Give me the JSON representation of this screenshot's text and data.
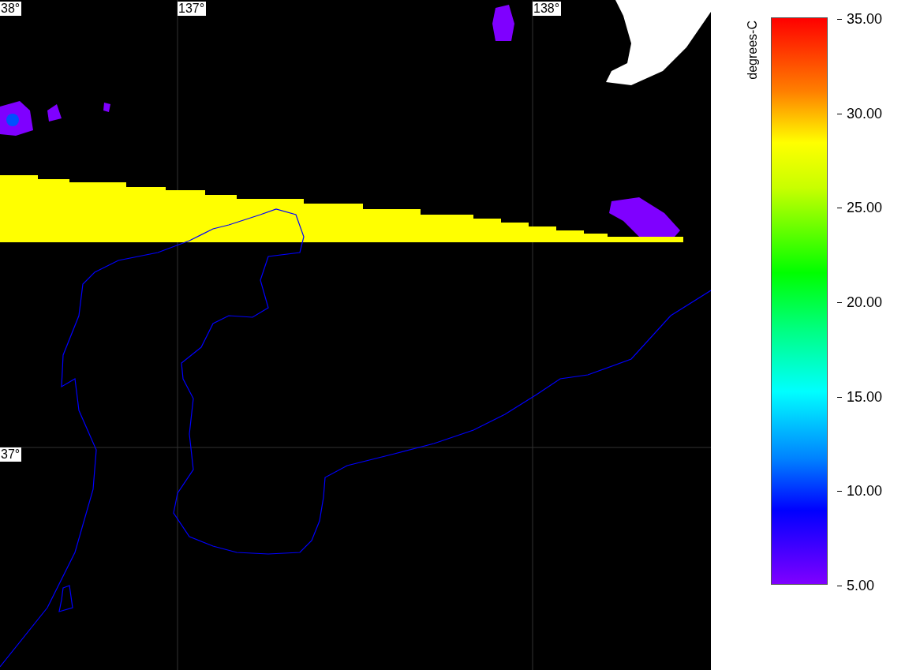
{
  "map": {
    "grid_labels": [
      {
        "text": "38°",
        "kind": "lat"
      },
      {
        "text": "137°",
        "kind": "lon"
      },
      {
        "text": "138°",
        "kind": "lon"
      },
      {
        "text": "37°",
        "kind": "lat"
      }
    ]
  },
  "legend": {
    "unit": "degrees-C",
    "ticks": [
      "35.00",
      "30.00",
      "25.00",
      "20.00",
      "15.00",
      "10.00",
      "5.00"
    ]
  }
}
